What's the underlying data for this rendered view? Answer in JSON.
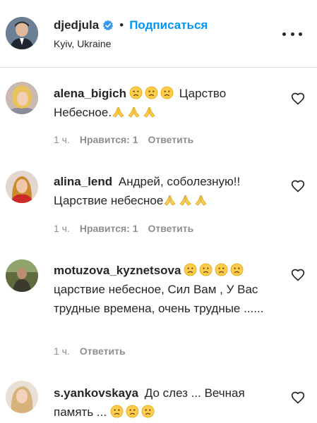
{
  "post": {
    "username": "djedjula",
    "follow_label": "Подписаться",
    "separator": "•",
    "location": "Kyiv, Ukraine"
  },
  "comments": [
    {
      "author": "alena_bigich",
      "text_before": "",
      "emoji_after_author": [
        "sad-face",
        "sad-face",
        "sad-face"
      ],
      "text": "Царство Небесное.",
      "emoji_after_text": [
        "folded-hands",
        "folded-hands",
        "folded-hands"
      ],
      "time": "1 ч.",
      "likes": "Нравится: 1",
      "reply": "Ответить"
    },
    {
      "author": "alina_lend",
      "text": "Андрей, соболезную!! Царствие небесное",
      "emoji_after_text": [
        "folded-hands",
        "folded-hands",
        "folded-hands"
      ],
      "time": "1 ч.",
      "likes": "Нравится: 1",
      "reply": "Ответить"
    },
    {
      "author": "motuzova_kyznetsova",
      "emoji_after_author": [
        "sad-face",
        "sad-face",
        "sad-face",
        "sad-face"
      ],
      "text": "царствие небесное, Сил Вам , У Вас трудные времена, очень трудные ......",
      "time": "1 ч.",
      "reply": "Ответить"
    },
    {
      "author": "s.yankovskaya",
      "text": "До слез ... Вечная память ...",
      "emoji_after_text": [
        "sad-face",
        "sad-face",
        "sad-face"
      ]
    }
  ],
  "colors": {
    "link_blue": "#0095f6",
    "meta_gray": "#8e8e8e",
    "text": "#262626",
    "emoji_yellow": "#ffcc4d"
  }
}
